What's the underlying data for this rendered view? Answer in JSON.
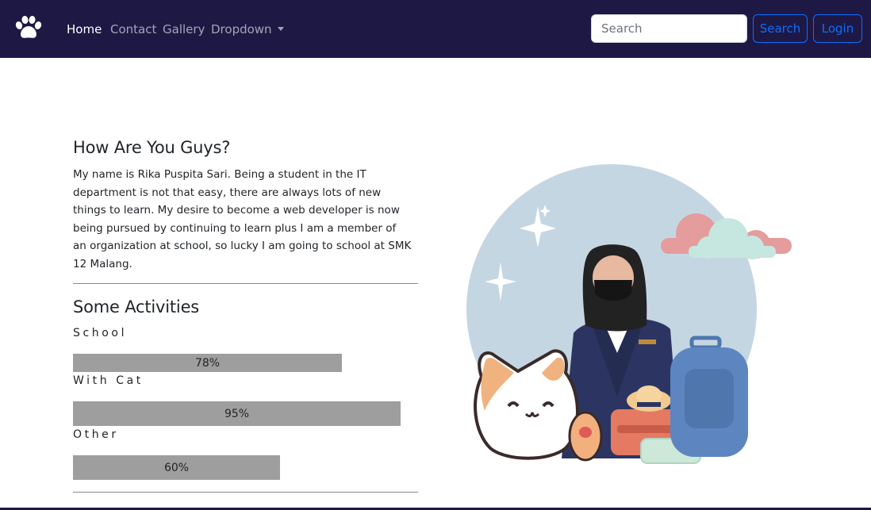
{
  "nav": {
    "brand_icon": "paw-icon",
    "items": [
      {
        "label": "Home",
        "active": true
      },
      {
        "label": "Contact",
        "active": false
      },
      {
        "label": "Gallery",
        "active": false
      },
      {
        "label": "Dropdown",
        "active": false
      }
    ],
    "search_placeholder": "Search",
    "search_button": "Search",
    "login_button": "Login"
  },
  "intro": {
    "title": "How Are You Guys?",
    "text": "My name is Rika Puspita Sari. Being a student in the IT department is not that easy, there are always lots of new things to learn. My desire to become a web developer is now being pursued by continuing to learn plus I am a member of an organization at school, so lucky I am going to school at SMK 12 Malang."
  },
  "activities": {
    "title": "Some Activities",
    "items": [
      {
        "label": "School",
        "value": 78,
        "text": "78%"
      },
      {
        "label": "With Cat",
        "value": 95,
        "text": "95%"
      },
      {
        "label": "Other",
        "value": 60,
        "text": "60%"
      }
    ]
  },
  "colors": {
    "navbar": "#1e1845",
    "accent": "#0d6efd",
    "bar": "#9e9e9e",
    "illustration_circle": "#c5d6e3"
  }
}
